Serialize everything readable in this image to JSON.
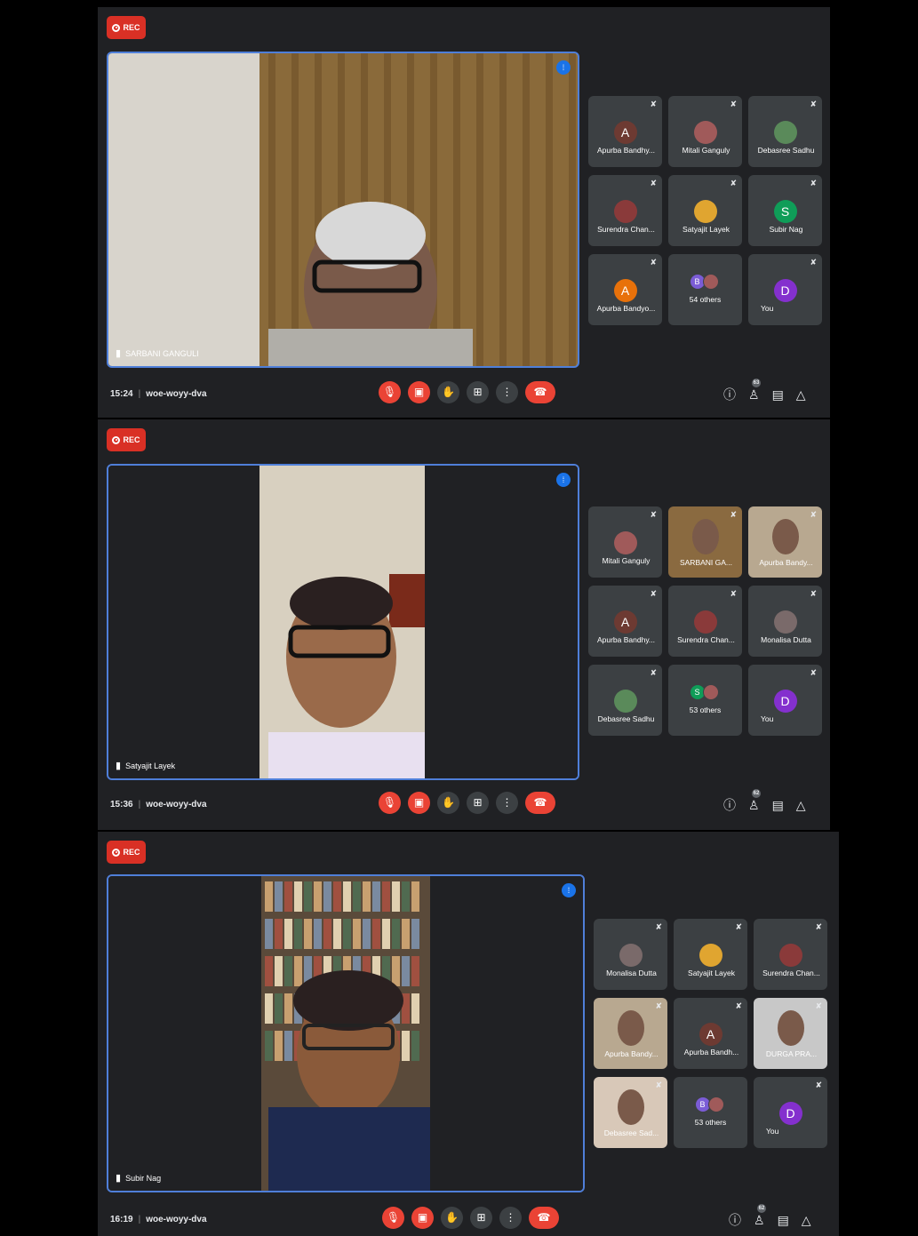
{
  "rec_label": "REC",
  "colors": {
    "accent": "#4f7fd9",
    "danger": "#ea4335",
    "panel": "#202124",
    "tile": "#3c4043"
  },
  "icons": {
    "mic_off": "mic-off-icon",
    "cam_off": "camera-off-icon",
    "hand": "raise-hand-icon",
    "present": "present-icon",
    "more": "more-vert-icon",
    "hangup": "hangup-icon",
    "info": "info-icon",
    "people": "people-icon",
    "chat": "chat-icon",
    "activities": "activities-icon"
  },
  "screens": [
    {
      "time": "15:24",
      "meeting_code": "woe-woyy-dva",
      "speaker": "SARBANI GANGULI",
      "people_count": "63",
      "tiles": [
        {
          "name": "Apurba Bandhy...",
          "kind": "avatar",
          "initial": "A",
          "color": "#6d3a32"
        },
        {
          "name": "Mitali Ganguly",
          "kind": "photo",
          "initial": "",
          "color": "#a05a5a"
        },
        {
          "name": "Debasree Sadhu",
          "kind": "photo",
          "initial": "",
          "color": "#5a8a5a"
        },
        {
          "name": "Surendra Chan...",
          "kind": "photo",
          "initial": "",
          "color": "#8a3a3a"
        },
        {
          "name": "Satyajit Layek",
          "kind": "photo",
          "initial": "",
          "color": "#e0a530"
        },
        {
          "name": "Subir Nag",
          "kind": "avatar",
          "initial": "S",
          "color": "#0f9d58"
        },
        {
          "name": "Apurba Bandyo...",
          "kind": "avatar",
          "initial": "A",
          "color": "#e8710a"
        },
        {
          "name": "54 others",
          "kind": "others",
          "initial": "B",
          "color": "#7b5cd6"
        },
        {
          "name": "You",
          "kind": "avatar",
          "initial": "D",
          "color": "#8430ce"
        }
      ]
    },
    {
      "time": "15:36",
      "meeting_code": "woe-woyy-dva",
      "speaker": "Satyajit Layek",
      "people_count": "62",
      "tiles": [
        {
          "name": "Mitali Ganguly",
          "kind": "photo",
          "initial": "",
          "color": "#a05a5a"
        },
        {
          "name": "SARBANI GA...",
          "kind": "video",
          "initial": "",
          "color": "#8a6a40"
        },
        {
          "name": "Apurba Bandy...",
          "kind": "video",
          "initial": "",
          "color": "#b8a890"
        },
        {
          "name": "Apurba Bandhy...",
          "kind": "avatar",
          "initial": "A",
          "color": "#6d3a32"
        },
        {
          "name": "Surendra Chan...",
          "kind": "photo",
          "initial": "",
          "color": "#8a3a3a"
        },
        {
          "name": "Monalisa Dutta",
          "kind": "photo",
          "initial": "",
          "color": "#7a6a6a"
        },
        {
          "name": "Debasree Sadhu",
          "kind": "photo",
          "initial": "",
          "color": "#5a8a5a"
        },
        {
          "name": "53 others",
          "kind": "others",
          "initial": "S",
          "color": "#0f9d58"
        },
        {
          "name": "You",
          "kind": "avatar",
          "initial": "D",
          "color": "#8430ce"
        }
      ]
    },
    {
      "time": "16:19",
      "meeting_code": "woe-woyy-dva",
      "speaker": "Subir Nag",
      "people_count": "62",
      "tiles": [
        {
          "name": "Monalisa Dutta",
          "kind": "photo",
          "initial": "",
          "color": "#7a6a6a"
        },
        {
          "name": "Satyajit Layek",
          "kind": "photo",
          "initial": "",
          "color": "#e0a530"
        },
        {
          "name": "Surendra Chan...",
          "kind": "photo",
          "initial": "",
          "color": "#8a3a3a"
        },
        {
          "name": "Apurba Bandy...",
          "kind": "video",
          "initial": "",
          "color": "#b8a890"
        },
        {
          "name": "Apurba Bandh...",
          "kind": "avatar",
          "initial": "A",
          "color": "#6d3a32"
        },
        {
          "name": "DURGA PRA...",
          "kind": "video",
          "initial": "",
          "color": "#c8c8c8"
        },
        {
          "name": "Debasree Sad...",
          "kind": "video",
          "initial": "",
          "color": "#d8c8b8"
        },
        {
          "name": "53 others",
          "kind": "others",
          "initial": "B",
          "color": "#7b5cd6"
        },
        {
          "name": "You",
          "kind": "avatar",
          "initial": "D",
          "color": "#8430ce"
        }
      ]
    }
  ]
}
